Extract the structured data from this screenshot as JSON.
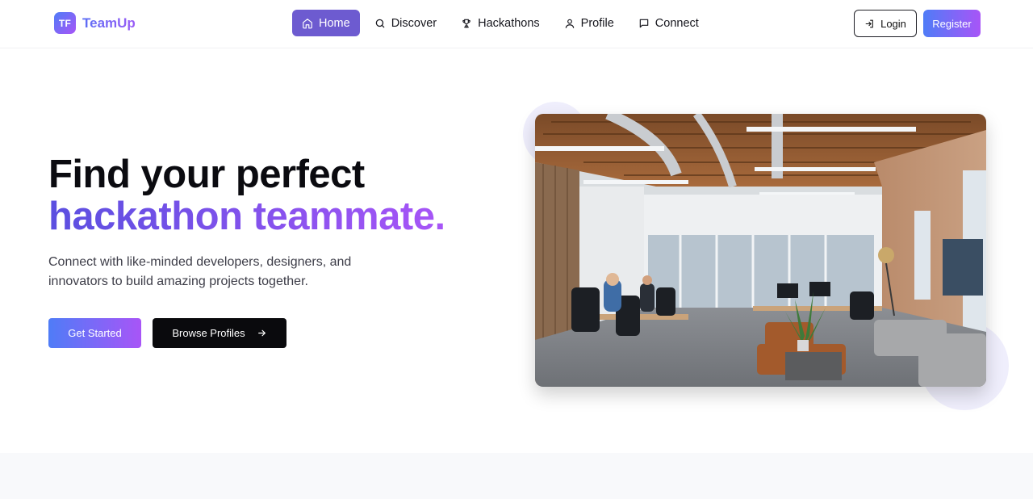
{
  "brand": {
    "mark": "TF",
    "name": "TeamUp"
  },
  "nav": {
    "items": [
      {
        "label": "Home",
        "icon": "home-icon",
        "active": true
      },
      {
        "label": "Discover",
        "icon": "search-icon"
      },
      {
        "label": "Hackathons",
        "icon": "trophy-icon"
      },
      {
        "label": "Profile",
        "icon": "user-icon"
      },
      {
        "label": "Connect",
        "icon": "chat-icon"
      }
    ]
  },
  "auth": {
    "login_label": "Login",
    "register_label": "Register"
  },
  "hero": {
    "title_line1": "Find your perfect",
    "title_line2": "hackathon teammate.",
    "subtitle": "Connect with like-minded developers, designers, and innovators to build amazing projects together.",
    "primary_cta": "Get Started",
    "secondary_cta": "Browse Profiles",
    "image_alt": "office-workspace-photo"
  },
  "colors": {
    "accent_start": "#4f7cf7",
    "accent_end": "#a855f7",
    "nav_active": "#6d5bd0"
  }
}
